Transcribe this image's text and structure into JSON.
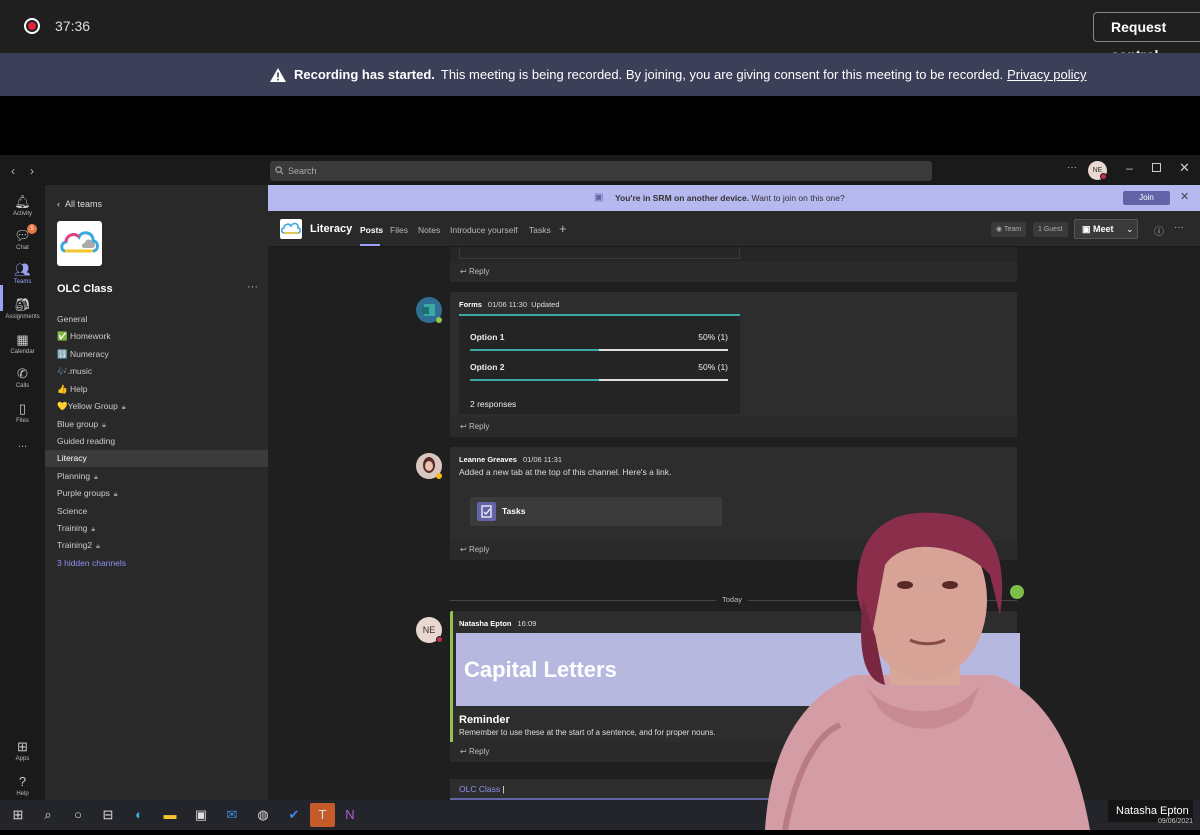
{
  "meeting": {
    "timer": "37:36",
    "request_control_label": "Request control",
    "banner": {
      "title": "Recording has started.",
      "message": "This meeting is being recorded. By joining, you are giving consent for this meeting to be recorded.",
      "link": "Privacy policy"
    },
    "participant_name": "Natasha Epton"
  },
  "teams": {
    "search_placeholder": "Search",
    "user_initials": "NE",
    "rail": {
      "items": [
        {
          "label": "Activity",
          "icon": "bell-icon"
        },
        {
          "label": "Chat",
          "icon": "chat-icon",
          "badge": "5"
        },
        {
          "label": "Teams",
          "icon": "teams-icon"
        },
        {
          "label": "Assignments",
          "icon": "assignments-icon"
        },
        {
          "label": "Calendar",
          "icon": "calendar-icon"
        },
        {
          "label": "Calls",
          "icon": "phone-icon"
        },
        {
          "label": "Files",
          "icon": "file-icon"
        },
        {
          "label": "...",
          "icon": "more-icon"
        },
        {
          "label": "Apps",
          "icon": "apps-icon"
        },
        {
          "label": "Help",
          "icon": "help-icon"
        }
      ]
    },
    "sidebar": {
      "back_label": "All teams",
      "team_name": "OLC Class",
      "more": "···",
      "channels": [
        {
          "prefix": "",
          "label": "General"
        },
        {
          "prefix": "✅",
          "label": "Homework"
        },
        {
          "prefix": "🔢",
          "label": "Numeracy"
        },
        {
          "prefix": "🎶",
          "label": ".music"
        },
        {
          "prefix": "👍",
          "label": "Help"
        },
        {
          "prefix": "💛",
          "label": "Yellow Group"
        },
        {
          "prefix": "",
          "label": "Blue group"
        },
        {
          "prefix": "",
          "label": "Guided reading"
        },
        {
          "prefix": "",
          "label": "Literacy"
        },
        {
          "prefix": "",
          "label": "Planning"
        },
        {
          "prefix": "",
          "label": "Purple groups"
        },
        {
          "prefix": "",
          "label": "Science"
        },
        {
          "prefix": "",
          "label": "Training"
        },
        {
          "prefix": "",
          "label": "Training2"
        },
        {
          "prefix": "",
          "label": "3 hidden channels"
        }
      ]
    },
    "srm_banner": {
      "bold": "You're in SRM on another device.",
      "text": "Want to join on this one?",
      "join_label": "Join"
    },
    "channel": {
      "title": "Literacy",
      "tabs": [
        "Posts",
        "Files",
        "Notes",
        "Introduce yourself",
        "Tasks"
      ],
      "team_label": "Team",
      "guest_label": "1 Guest",
      "meet_label": "Meet"
    },
    "posts": {
      "reply_label": "Reply",
      "forms": {
        "author": "Forms",
        "time": "01/06 11:30",
        "status": "Updated",
        "options": [
          {
            "label": "Option 1",
            "result": "50% (1)",
            "fraction": 0.5
          },
          {
            "label": "Option 2",
            "result": "50% (1)",
            "fraction": 0.5
          }
        ],
        "responses": "2 responses"
      },
      "leanne": {
        "author": "Leanne Greaves",
        "time": "01/06 11:31",
        "text": "Added a new tab at the top of this channel. Here's a link.",
        "card_label": "Tasks"
      },
      "divider": "Today",
      "natasha": {
        "author": "Natasha Epton",
        "initials": "NE",
        "time": "16:09",
        "banner_title": "Capital Letters",
        "subtitle": "Reminder",
        "text": "Remember to use these at the start of a sentence, and for proper nouns."
      }
    },
    "composer": {
      "value": "OLC Class"
    }
  },
  "taskbar": {
    "date": "09/06/2021"
  },
  "colors": {
    "accent": "#6264a7",
    "banner_bg": "#3c3f58",
    "poll_teal": "#3aa8a4",
    "card_lilac": "#b6b8e0"
  }
}
